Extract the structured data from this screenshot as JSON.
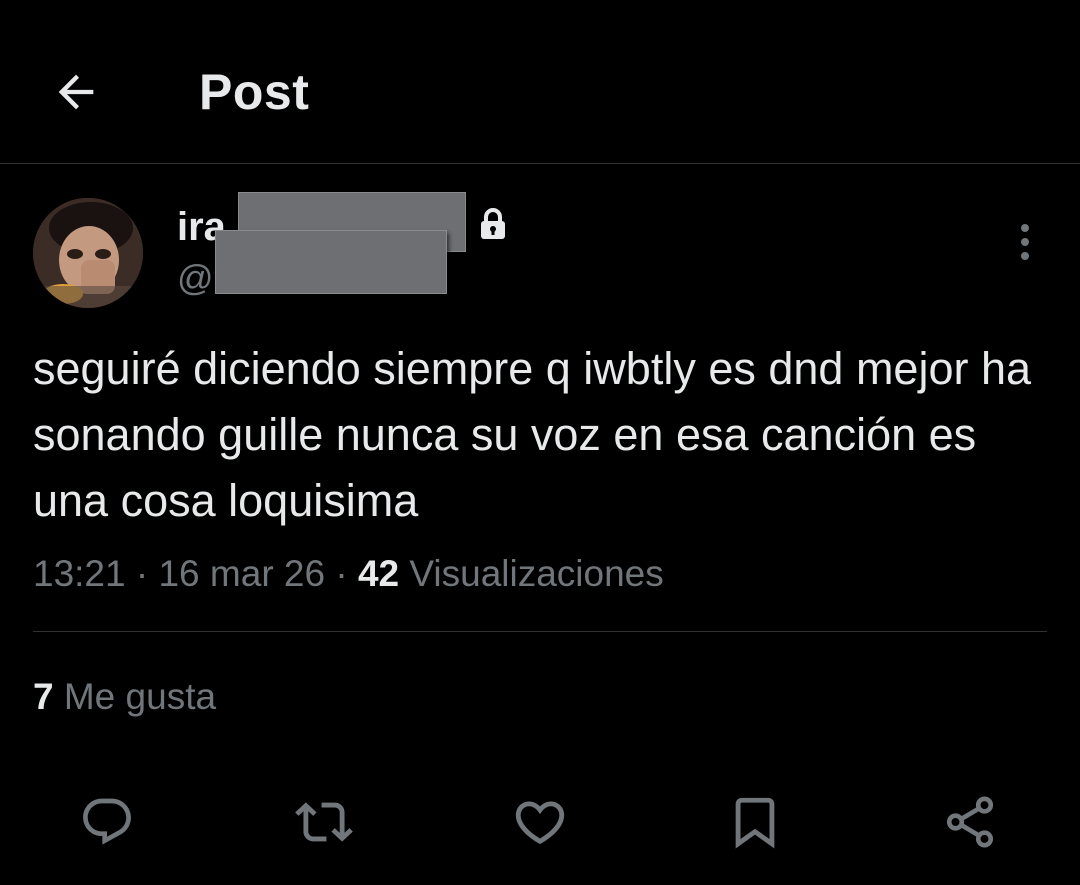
{
  "header": {
    "title": "Post",
    "back_icon": "arrow-left-icon"
  },
  "author": {
    "display_name_visible": "ira",
    "handle_prefix": "@",
    "protected_icon": "lock-icon",
    "more_icon": "more-vertical-icon"
  },
  "post": {
    "text": "seguiré diciendo siempre q iwbtly es dnd mejor ha sonando guille nunca su voz en esa canción es una cosa loquisima",
    "time": "13:21",
    "separator": "·",
    "date": "16 mar 26",
    "views_count": "42",
    "views_label": "Visualizaciones"
  },
  "stats": {
    "likes_count": "7",
    "likes_label": "Me gusta"
  },
  "actions": [
    {
      "name": "reply",
      "icon": "reply-icon"
    },
    {
      "name": "repost",
      "icon": "repost-icon"
    },
    {
      "name": "like",
      "icon": "heart-icon"
    },
    {
      "name": "bookmark",
      "icon": "bookmark-icon"
    },
    {
      "name": "share",
      "icon": "share-icon"
    }
  ],
  "colors": {
    "background": "#000000",
    "primary_text": "#e7e9ea",
    "secondary_text": "#71767b",
    "divider": "#2f3336",
    "redaction": "#6e6f72"
  }
}
